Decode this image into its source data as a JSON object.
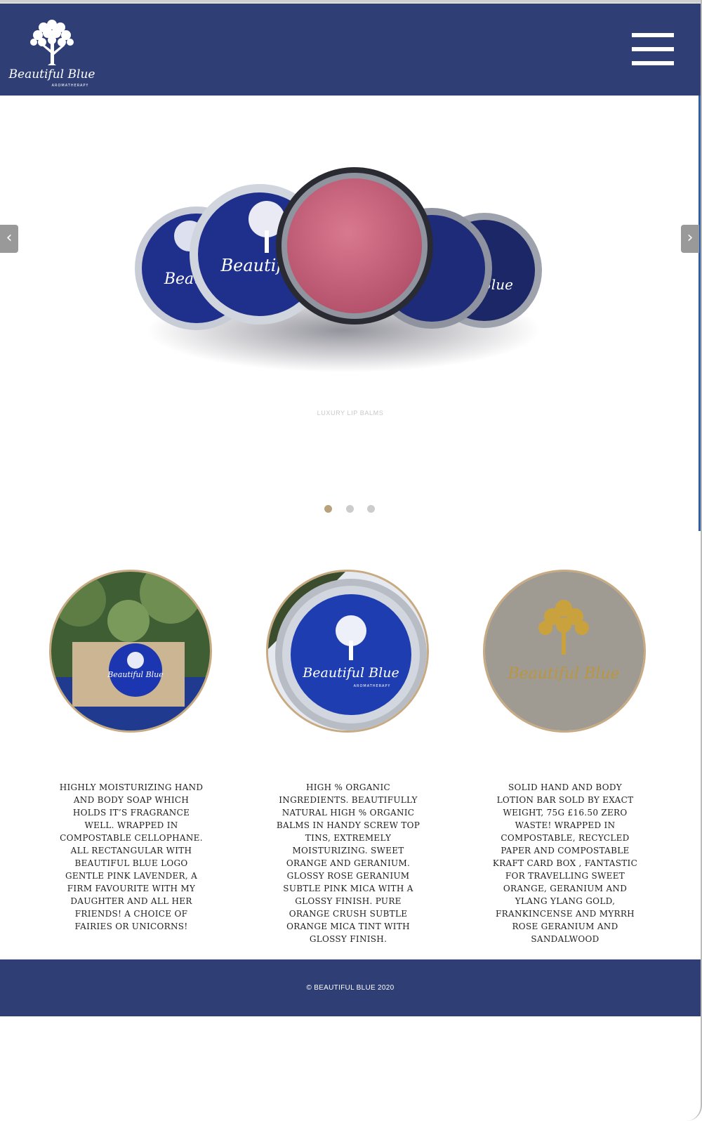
{
  "brand": {
    "logo_script": "Beautiful Blue",
    "logo_sub": "AROMATHERAPY"
  },
  "header": {
    "menu_icon": "hamburger-icon",
    "background": "#2f3f75"
  },
  "slider": {
    "caption": "LUXURY LIP BALMS",
    "prev_label": "‹",
    "next_label": "›",
    "dots": [
      {
        "active": true,
        "color": "#b8a27c"
      },
      {
        "active": false,
        "color": "#cccccc"
      },
      {
        "active": false,
        "color": "#cccccc"
      }
    ]
  },
  "features": [
    {
      "image": "soap-box-photo",
      "text": "Highly moisturizing hand and body soap which holds it’s fragrance well. Wrapped in compostable cellophane. All rectangular with Beautiful Blue logo Gentle Pink Lavender, a firm favourite with my daughter and all her friends! A choice of fairies or unicorns!"
    },
    {
      "image": "lip-balm-tin-photo",
      "text": "High % organic ingredients. Beautifully natural high % organic balms in handy screw top tins, extremely moisturizing. Sweet Orange and Geranium. Glossy Rose Geranium subtle pink mica with a glossy finish. Pure Orange Crush subtle orange mica tint with glossy finish."
    },
    {
      "image": "lotion-bar-photo",
      "text": "Solid hand and body lotion bar sold by exact weight, 75g £16.50 Zero waste! Wrapped in compostable, recycled paper and compostable kraft card box , fantastic for travelling Sweet Orange, Geranium and Ylang Ylang Gold, Frankincense and Myrrh Rose Geranium and Sandalwood"
    }
  ],
  "footer": {
    "copyright": "© BEAUTIFUL BLUE 2020"
  },
  "colors": {
    "navy": "#2f3f75",
    "gold": "#c8aa82",
    "tin_blue": "#1f2f8c",
    "balm_pink": "#c6627a"
  }
}
